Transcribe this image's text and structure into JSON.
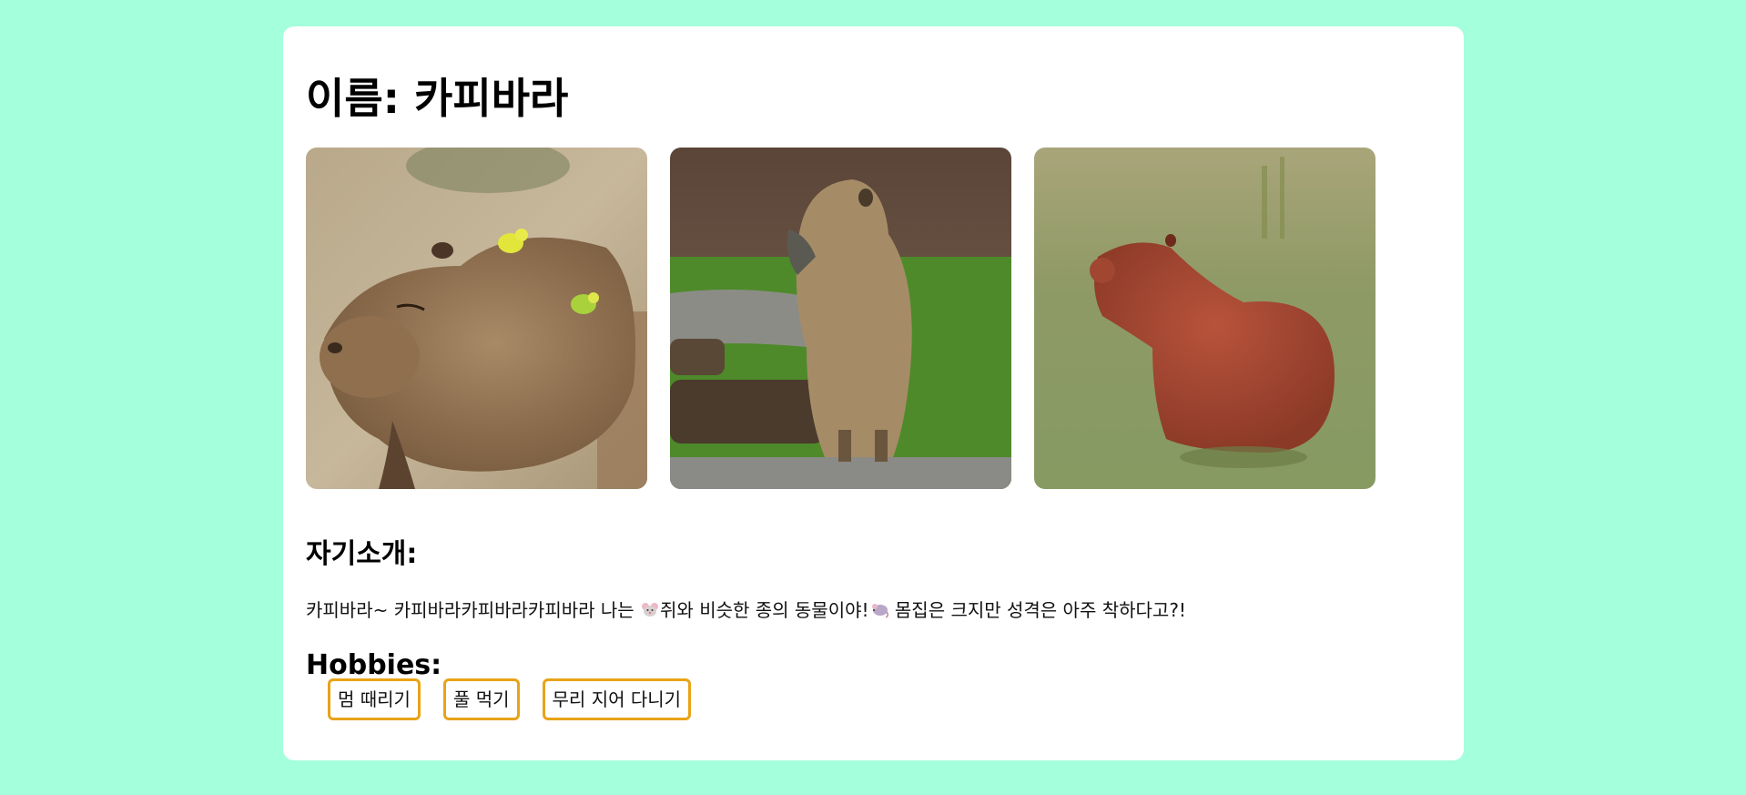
{
  "profile": {
    "title": "이름: 카피바라",
    "intro_heading": "자기소개:",
    "intro_parts": [
      "카피바라~ 카피바라카피바라카피바라 나는 ",
      "쥐와 비슷한 종의 동물이야!",
      " 몸집은 크지만 성격은 아주 착하다고?!"
    ],
    "hobbies_heading": "Hobbies:",
    "hobbies": [
      "멈 때리기",
      "풀 먹기",
      "무리 지어 다니기"
    ]
  },
  "photos": [
    {
      "icon": "capybara-with-birds-photo"
    },
    {
      "icon": "capybara-sitting-photo"
    },
    {
      "icon": "capybara-red-photo"
    }
  ],
  "colors": {
    "background": "#a3ffdc",
    "card": "#ffffff",
    "hobby_border": "#e8a317"
  }
}
